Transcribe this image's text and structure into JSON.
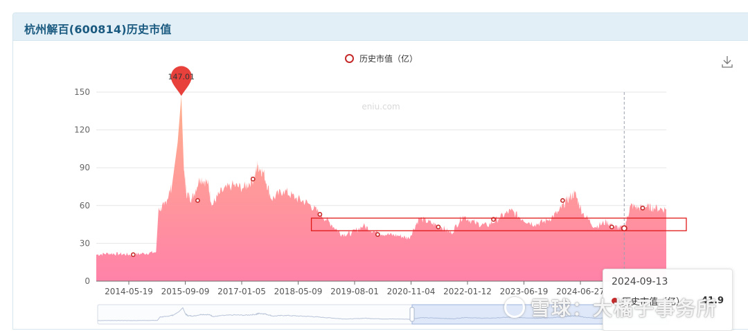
{
  "panel": {
    "title": "杭州解百(600814)历史市值"
  },
  "legend": {
    "label": "历史市值（亿）"
  },
  "watermark_site": "eniu.com",
  "watermark_brand": "雪球：大橘子事务所",
  "icons": {
    "download": "download-icon",
    "legend_marker": "circle-icon"
  },
  "tooltip": {
    "date": "2024-09-13",
    "series": "历史市值（亿）",
    "value": "41.9"
  },
  "colors": {
    "area_top": "#ffb08c",
    "area_bottom": "#ff82a8",
    "marker": "#c62a2a",
    "highlight_box": "#e01818",
    "header_bg": "#e2eff6",
    "title": "#1a5a80"
  },
  "chart_data": {
    "type": "area",
    "series": [
      {
        "name": "历史市值（亿）"
      }
    ],
    "y_ticks": [
      0,
      30,
      60,
      90,
      120,
      150
    ],
    "ylim": [
      0,
      150
    ],
    "x_tick_labels": [
      "2014-05-19",
      "2015-09-09",
      "2017-01-05",
      "2018-05-09",
      "2019-08-01",
      "2020-11-04",
      "2022-01-12",
      "2023-06-19",
      "2024-06-27"
    ],
    "x_range": [
      "2013-09-01",
      "2025-07-31"
    ],
    "peak": {
      "date": "2015-06-12",
      "value": 147.01,
      "label": "147.01"
    },
    "points": [
      [
        "2013-09-01",
        21
      ],
      [
        "2013-12-01",
        22
      ],
      [
        "2014-03-01",
        21.5
      ],
      [
        "2014-06-01",
        21
      ],
      [
        "2014-09-01",
        22
      ],
      [
        "2014-12-01",
        23
      ],
      [
        "2014-12-20",
        56
      ],
      [
        "2015-02-01",
        60
      ],
      [
        "2015-04-01",
        75
      ],
      [
        "2015-05-15",
        110
      ],
      [
        "2015-06-12",
        147.01
      ],
      [
        "2015-07-01",
        90
      ],
      [
        "2015-07-20",
        70
      ],
      [
        "2015-09-01",
        65
      ],
      [
        "2015-11-01",
        82
      ],
      [
        "2016-01-01",
        78
      ],
      [
        "2016-02-01",
        60
      ],
      [
        "2016-04-01",
        70
      ],
      [
        "2016-07-01",
        76
      ],
      [
        "2016-10-01",
        74
      ],
      [
        "2016-12-20",
        82
      ],
      [
        "2017-01-15",
        92
      ],
      [
        "2017-03-01",
        86
      ],
      [
        "2017-05-01",
        65
      ],
      [
        "2017-08-01",
        72
      ],
      [
        "2017-11-01",
        66
      ],
      [
        "2018-02-01",
        62
      ],
      [
        "2018-05-01",
        54
      ],
      [
        "2018-08-01",
        45
      ],
      [
        "2018-10-20",
        37
      ],
      [
        "2019-01-01",
        38
      ],
      [
        "2019-04-01",
        44
      ],
      [
        "2019-07-01",
        39
      ],
      [
        "2019-10-01",
        37
      ],
      [
        "2020-01-01",
        36
      ],
      [
        "2020-03-15",
        34
      ],
      [
        "2020-06-01",
        50
      ],
      [
        "2020-09-01",
        46
      ],
      [
        "2020-11-15",
        43
      ],
      [
        "2021-02-01",
        38
      ],
      [
        "2021-05-01",
        52
      ],
      [
        "2021-08-01",
        46
      ],
      [
        "2021-11-01",
        44
      ],
      [
        "2022-02-01",
        50
      ],
      [
        "2022-05-01",
        56
      ],
      [
        "2022-08-01",
        49
      ],
      [
        "2022-11-01",
        45
      ],
      [
        "2023-02-01",
        48
      ],
      [
        "2023-05-01",
        55
      ],
      [
        "2023-07-01",
        64
      ],
      [
        "2023-09-01",
        70
      ],
      [
        "2023-11-01",
        54
      ],
      [
        "2024-02-01",
        43
      ],
      [
        "2024-05-01",
        47
      ],
      [
        "2024-07-01",
        43
      ],
      [
        "2024-09-13",
        41.9
      ],
      [
        "2024-11-01",
        60
      ],
      [
        "2025-01-01",
        58
      ],
      [
        "2025-03-01",
        59
      ],
      [
        "2025-05-01",
        58
      ],
      [
        "2025-07-31",
        57
      ]
    ],
    "markers": [
      [
        "2014-06-10",
        21
      ],
      [
        "2015-10-15",
        64
      ],
      [
        "2016-12-10",
        81
      ],
      [
        "2018-05-05",
        53
      ],
      [
        "2019-07-20",
        37
      ],
      [
        "2020-10-25",
        43
      ],
      [
        "2021-12-20",
        49
      ],
      [
        "2023-06-01",
        64
      ],
      [
        "2024-06-10",
        43
      ],
      [
        "2025-02-01",
        58
      ]
    ],
    "cursor_date": "2024-09-13",
    "highlight_range": {
      "x": [
        "2018-03-01",
        "2025-12-31"
      ],
      "y": [
        40,
        50
      ]
    }
  }
}
